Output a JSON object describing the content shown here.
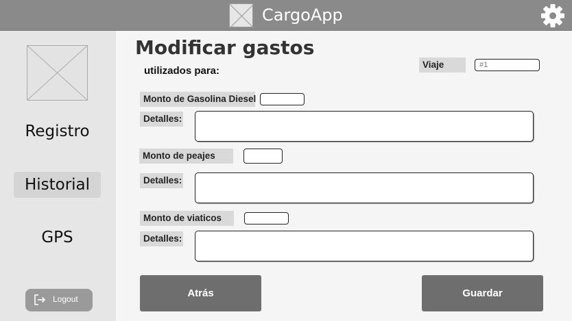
{
  "header": {
    "app_name": "CargoApp",
    "logo_icon": "image-placeholder-icon",
    "settings_icon": "gear-icon"
  },
  "sidebar": {
    "avatar_icon": "image-placeholder-icon",
    "items": [
      {
        "label": "Registro",
        "active": false
      },
      {
        "label": "Historial",
        "active": true
      },
      {
        "label": "GPS",
        "active": false
      }
    ],
    "logout_label": "Logout",
    "logout_icon": "logout-icon"
  },
  "main": {
    "title": "Modificar gastos",
    "subtitle": "utilizados para:",
    "trip": {
      "label": "Viaje",
      "placeholder": "#1"
    },
    "sections": [
      {
        "amount_label": "Monto de Gasolina Diesel",
        "details_label": "Detalles:"
      },
      {
        "amount_label": "Monto de peajes",
        "details_label": "Detalles:"
      },
      {
        "amount_label": "Monto de viaticos",
        "details_label": "Detalles:"
      }
    ],
    "back_label": "Atrás",
    "save_label": "Guardar"
  },
  "colors": {
    "header_bg": "#8a8a8a",
    "sidebar_bg": "#e6e6e6",
    "button_bg": "#6e6e6e"
  }
}
